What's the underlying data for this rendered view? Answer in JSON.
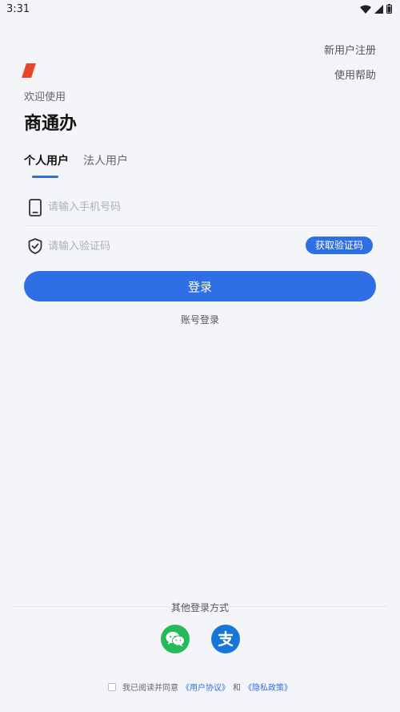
{
  "status_bar": {
    "time": "3:31"
  },
  "top_links": {
    "register": "新用户注册",
    "help": "使用帮助"
  },
  "header": {
    "welcome": "欢迎使用",
    "app_title": "商通办"
  },
  "tabs": [
    {
      "label": "个人用户",
      "active": true
    },
    {
      "label": "法人用户",
      "active": false
    }
  ],
  "form": {
    "phone_placeholder": "请输入手机号码",
    "code_placeholder": "请输入验证码",
    "get_code_label": "获取验证码",
    "login_label": "登录",
    "account_login_label": "账号登录"
  },
  "other_login": {
    "title": "其他登录方式",
    "methods": [
      {
        "name": "WeChat",
        "icon": "wechat-icon",
        "color": "#26bb5a"
      },
      {
        "name": "Alipay",
        "icon": "alipay-icon",
        "color": "#1677d8"
      }
    ]
  },
  "agreement": {
    "prefix": "我已阅读并同意",
    "user_agreement": "《用户协议》",
    "and": "和",
    "privacy_policy": "《隐私政策》"
  },
  "colors": {
    "primary": "#2f6fe6",
    "brand_accent": "#e8452c",
    "background": "#f4f5f8"
  }
}
